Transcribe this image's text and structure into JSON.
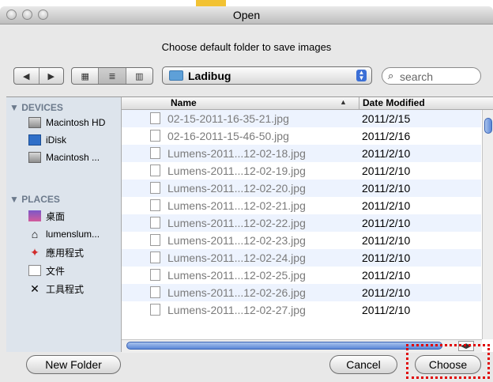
{
  "window": {
    "title": "Open"
  },
  "prompt": "Choose default folder to save images",
  "toolbar": {
    "back_icon": "◀",
    "forward_icon": "▶",
    "view_icon_icon": "▦",
    "view_list_icon": "≣",
    "view_column_icon": "▥",
    "folder_popup_label": "Ladibug",
    "search_placeholder": "search"
  },
  "sidebar": {
    "devices_header": "▼ DEVICES",
    "devices": [
      "Macintosh HD",
      "iDisk",
      "Macintosh ..."
    ],
    "places_header": "▼ PLACES",
    "places": [
      "桌面",
      "lumenslum...",
      "應用程式",
      "文件",
      "工具程式"
    ]
  },
  "columns": {
    "name": "Name",
    "date": "Date Modified",
    "sort_icon": "▲"
  },
  "files": [
    {
      "name": "02-15-2011-16-35-21.jpg",
      "date": "2011/2/15"
    },
    {
      "name": "02-16-2011-15-46-50.jpg",
      "date": "2011/2/16"
    },
    {
      "name": "Lumens-2011...12-02-18.jpg",
      "date": "2011/2/10"
    },
    {
      "name": "Lumens-2011...12-02-19.jpg",
      "date": "2011/2/10"
    },
    {
      "name": "Lumens-2011...12-02-20.jpg",
      "date": "2011/2/10"
    },
    {
      "name": "Lumens-2011...12-02-21.jpg",
      "date": "2011/2/10"
    },
    {
      "name": "Lumens-2011...12-02-22.jpg",
      "date": "2011/2/10"
    },
    {
      "name": "Lumens-2011...12-02-23.jpg",
      "date": "2011/2/10"
    },
    {
      "name": "Lumens-2011...12-02-24.jpg",
      "date": "2011/2/10"
    },
    {
      "name": "Lumens-2011...12-02-25.jpg",
      "date": "2011/2/10"
    },
    {
      "name": "Lumens-2011...12-02-26.jpg",
      "date": "2011/2/10"
    },
    {
      "name": "Lumens-2011...12-02-27.jpg",
      "date": "2011/2/10"
    }
  ],
  "buttons": {
    "new_folder": "New Folder",
    "cancel": "Cancel",
    "choose": "Choose"
  },
  "colors": {
    "highlight": "#e00000",
    "accent": "#3b6fd6",
    "sidebar_bg": "#dde4ec"
  }
}
